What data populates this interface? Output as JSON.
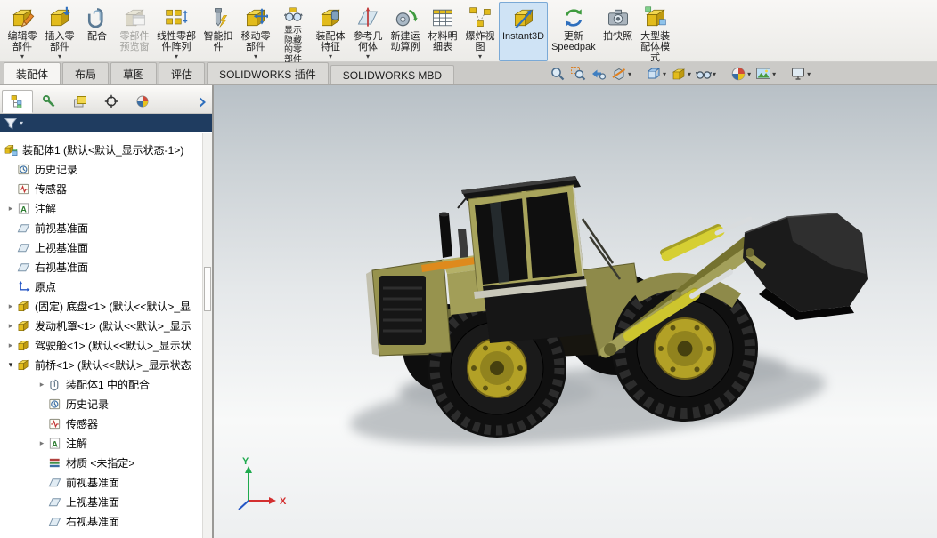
{
  "app": {
    "name": "SOLIDWORKS"
  },
  "toolbar": {
    "buttons": [
      {
        "label": "编辑零\n部件",
        "caret": "▾"
      },
      {
        "label": "插入零\n部件",
        "caret": "▾"
      },
      {
        "label": "配合",
        "caret": ""
      },
      {
        "label": "零部件\n预览窗",
        "caret": "",
        "disabled": true
      },
      {
        "label": "线性零部\n件阵列",
        "caret": "▾"
      },
      {
        "label": "智能扣\n件",
        "caret": ""
      },
      {
        "label": "移动零\n部件",
        "caret": "▾"
      },
      {
        "label": "显示\n隐藏\n的零\n部件",
        "caret": ""
      },
      {
        "label": "装配体\n特征",
        "caret": "▾"
      },
      {
        "label": "参考几\n何体",
        "caret": "▾"
      },
      {
        "label": "新建运\n动算例",
        "caret": ""
      },
      {
        "label": "材料明\n细表",
        "caret": ""
      },
      {
        "label": "爆炸视\n图",
        "caret": "▾"
      },
      {
        "label": "Instant3D",
        "caret": "",
        "active": true
      },
      {
        "label": "更新\nSpeedpak",
        "caret": ""
      },
      {
        "label": "拍快照",
        "caret": ""
      },
      {
        "label": "大型装\n配体模\n式",
        "caret": ""
      }
    ]
  },
  "ribbon_tabs": [
    {
      "label": "装配体",
      "active": true
    },
    {
      "label": "布局",
      "active": false
    },
    {
      "label": "草图",
      "active": false
    },
    {
      "label": "评估",
      "active": false
    },
    {
      "label": "SOLIDWORKS 插件",
      "active": false
    },
    {
      "label": "SOLIDWORKS MBD",
      "active": false
    }
  ],
  "view_toolbar_icons": [
    "zoom-to-fit",
    "zoom-to-area",
    "previous-view",
    "section-view",
    "view-orientation",
    "display-style",
    "hide-show-items",
    "edit-appearance",
    "apply-scene",
    "view-settings"
  ],
  "panel_tab_icons": [
    "featuremanager-tree",
    "propertymanager",
    "configurationmanager",
    "dimxpertmanager",
    "displaymanager"
  ],
  "feature_tree": {
    "items": [
      {
        "label": "装配体1 (默认<默认_显示状态-1>)"
      },
      {
        "label": "历史记录"
      },
      {
        "label": "传感器"
      },
      {
        "label": "注解"
      },
      {
        "label": "前视基准面"
      },
      {
        "label": "上视基准面"
      },
      {
        "label": "右视基准面"
      },
      {
        "label": "原点"
      },
      {
        "label": "(固定) 底盘<1> (默认<<默认>_显"
      },
      {
        "label": "发动机罩<1> (默认<<默认>_显示"
      },
      {
        "label": "驾驶舱<1> (默认<<默认>_显示状"
      },
      {
        "label": "前桥<1> (默认<<默认>_显示状态"
      },
      {
        "label": "装配体1 中的配合"
      },
      {
        "label": "历史记录"
      },
      {
        "label": "传感器"
      },
      {
        "label": "注解"
      },
      {
        "label": "材质 <未指定>"
      },
      {
        "label": "前视基准面"
      },
      {
        "label": "上视基准面"
      },
      {
        "label": "右视基准面"
      }
    ]
  },
  "triad": {
    "x_label": "X",
    "y_label": "Y"
  },
  "colors": {
    "body_khaki": "#a5a158",
    "wheel_hub": "#b3a126",
    "accent_orange": "#de8a1c",
    "selection_blue": "#cfe3f5",
    "filter_bar": "#1f3c60"
  }
}
